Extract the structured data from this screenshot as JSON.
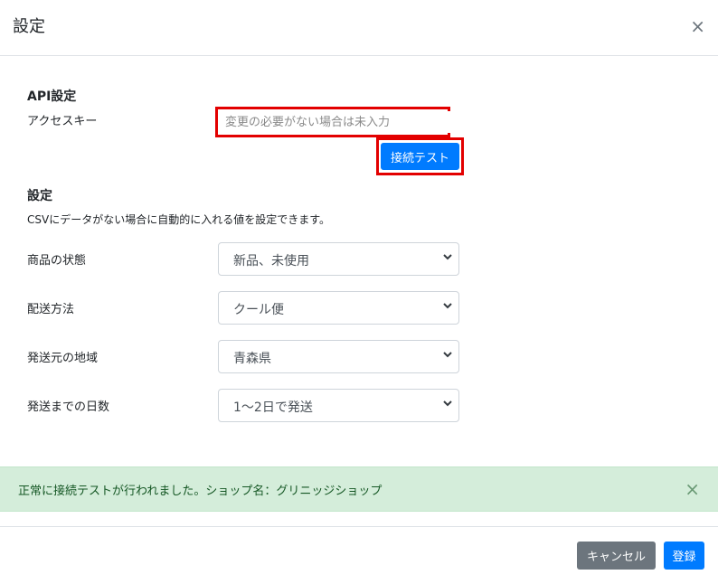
{
  "modal": {
    "title": "設定",
    "close_glyph": "×"
  },
  "api_section": {
    "title": "API設定",
    "access_key_label": "アクセスキー",
    "access_key_placeholder": "変更の必要がない場合は未入力",
    "access_key_value": "",
    "test_button_label": "接続テスト"
  },
  "settings_section": {
    "title": "設定",
    "description": "CSVにデータがない場合に自動的に入れる値を設定できます。",
    "fields": [
      {
        "label": "商品の状態",
        "value": "新品、未使用"
      },
      {
        "label": "配送方法",
        "value": "クール便"
      },
      {
        "label": "発送元の地域",
        "value": "青森県"
      },
      {
        "label": "発送までの日数",
        "value": "1〜2日で発送"
      }
    ]
  },
  "alert": {
    "message": "正常に接続テストが行われました。ショップ名：グリニッジショップ",
    "close_glyph": "×"
  },
  "footer": {
    "cancel_label": "キャンセル",
    "save_label": "登録"
  },
  "colors": {
    "primary": "#007bff",
    "secondary": "#6c757d",
    "highlight": "#e30000",
    "success_bg": "#d4edda",
    "success_text": "#155724"
  },
  "icons": {
    "close": "close-icon",
    "dropdown": "chevron-down-icon"
  }
}
